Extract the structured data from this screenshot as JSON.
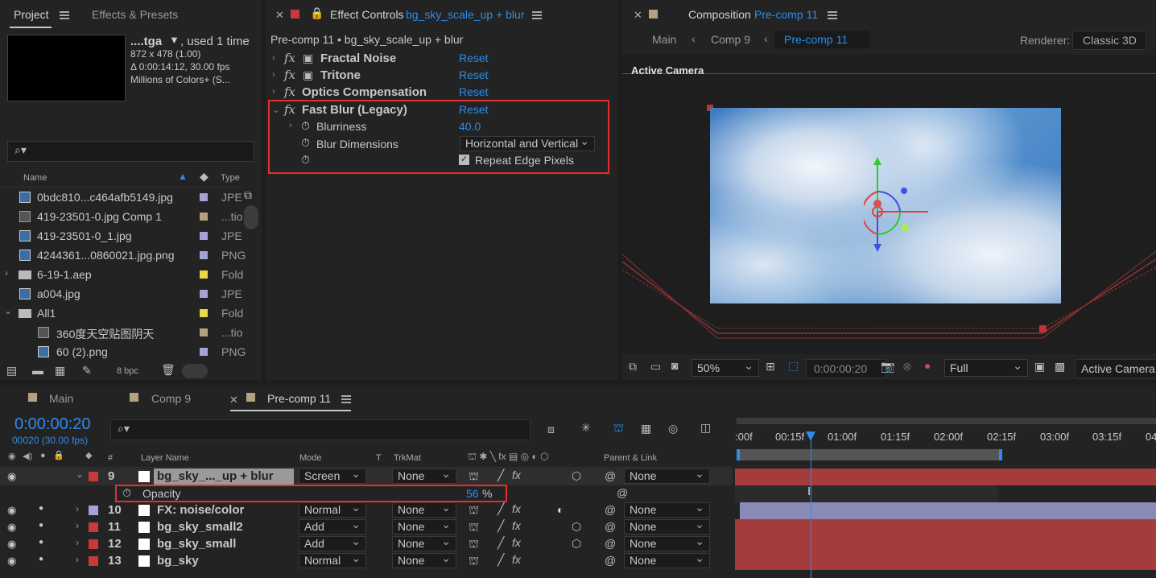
{
  "project": {
    "tabs": [
      "Project",
      "Effects & Presets"
    ],
    "thumb": {
      "name": "....tga",
      "used": ", used 1 time",
      "dims": "872 x 478 (1.00)",
      "duration": "Δ 0:00:14:12, 30.00 fps",
      "colors": "Millions of Colors+ (S..."
    },
    "search_placeholder": "⌕▾",
    "columns": {
      "name": "Name",
      "type": "Type"
    },
    "items": [
      {
        "name": "0bdc810...c464afb5149.jpg",
        "type": "JPE",
        "color": "#a3a3d8"
      },
      {
        "name": "419-23501-0.jpg Comp 1",
        "type": "...tio",
        "color": "#b5a17d"
      },
      {
        "name": "419-23501-0_1.jpg",
        "type": "JPE",
        "color": "#a3a3d8"
      },
      {
        "name": "4244361...0860021.jpg.png",
        "type": "PNG",
        "color": "#a3a3d8"
      },
      {
        "name": "6-19-1.aep",
        "type": "Fold",
        "color": "#e8d84a"
      },
      {
        "name": "a004.jpg",
        "type": "JPE",
        "color": "#a3a3d8"
      },
      {
        "name": "All1",
        "type": "Fold",
        "color": "#e8d84a"
      },
      {
        "name": "360度天空贴图阴天",
        "type": "...tio",
        "color": "#b5a17d"
      },
      {
        "name": "60 (2).png",
        "type": "PNG",
        "color": "#a3a3d8"
      }
    ],
    "bpc": "8 bpc"
  },
  "effect_controls": {
    "tab_label": "Effect Controls",
    "tab_layer": "bg_sky_scale_up + blur",
    "header": "Pre-comp 11 • bg_sky_scale_up + blur",
    "effects": [
      {
        "name": "Fractal Noise",
        "reset": "Reset"
      },
      {
        "name": "Tritone",
        "reset": "Reset"
      },
      {
        "name": "Optics Compensation",
        "reset": "Reset"
      },
      {
        "name": "Fast Blur (Legacy)",
        "reset": "Reset"
      }
    ],
    "blurriness_label": "Blurriness",
    "blurriness_value": "40.0",
    "dimensions_label": "Blur Dimensions",
    "dimensions_value": "Horizontal and Vertical",
    "repeat_label": "Repeat Edge Pixels"
  },
  "composition": {
    "tab_label": "Composition",
    "tab_name": "Pre-comp 11",
    "breadcrumbs": [
      "Main",
      "Comp 9",
      "Pre-comp 11"
    ],
    "renderer_label": "Renderer:",
    "renderer_value": "Classic 3D",
    "camera_label": "Active Camera",
    "zoom": "50%",
    "timecode": "0:00:00:20",
    "resolution": "Full",
    "view": "Active Camera"
  },
  "timeline": {
    "tabs": [
      "Main",
      "Comp 9",
      "Pre-comp 11"
    ],
    "timecode": "0:00:00:20",
    "frames": "00020 (30.00 fps)",
    "search_placeholder": "⌕▾",
    "columns": {
      "num": "#",
      "layer_name": "Layer Name",
      "mode": "Mode",
      "t": "T",
      "trkmat": "TrkMat",
      "parent": "Parent & Link"
    },
    "ruler": [
      ":00f",
      "00:15f",
      "01:00f",
      "01:15f",
      "02:00f",
      "02:15f",
      "03:00f",
      "03:15f",
      "04"
    ],
    "layers": [
      {
        "num": "9",
        "name": "bg_sky_..._up + blur",
        "mode": "Screen",
        "trkmat": "None",
        "parent": "None",
        "label": "#c83a3a"
      },
      {
        "num": "10",
        "name": "FX: noise/color",
        "mode": "Normal",
        "trkmat": "None",
        "parent": "None",
        "label": "#a3a3d8"
      },
      {
        "num": "11",
        "name": "bg_sky_small2",
        "mode": "Add",
        "trkmat": "None",
        "parent": "None",
        "label": "#c83a3a"
      },
      {
        "num": "12",
        "name": "bg_sky_small",
        "mode": "Add",
        "trkmat": "None",
        "parent": "None",
        "label": "#c83a3a"
      },
      {
        "num": "13",
        "name": "bg_sky",
        "mode": "Normal",
        "trkmat": "None",
        "parent": "None",
        "label": "#c83a3a"
      }
    ],
    "opacity_label": "Opacity",
    "opacity_value": "56",
    "opacity_unit": "%"
  },
  "colors": {
    "accent": "#2d8ceb",
    "highlight": "#e03030",
    "layer_red": "#a53c3c",
    "layer_purple": "#8a8ab8"
  }
}
